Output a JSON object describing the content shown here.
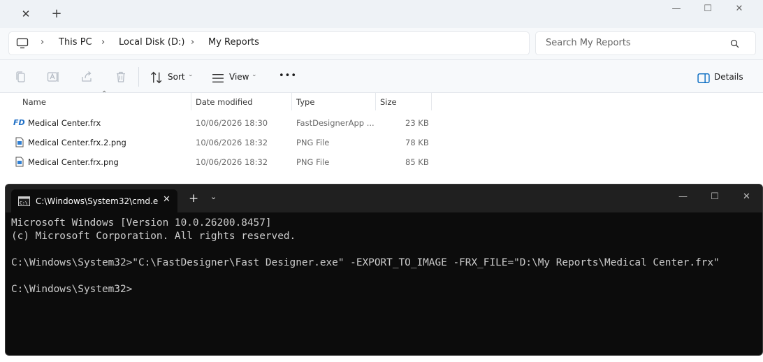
{
  "explorer": {
    "tab": {
      "close_glyph": "✕",
      "new_glyph": "+"
    },
    "window": {
      "minimize_glyph": "—",
      "maximize_glyph": "☐",
      "close_glyph": "✕"
    },
    "breadcrumb": [
      "This PC",
      "Local Disk (D:)",
      "My Reports"
    ],
    "breadcrumb_separator": "›",
    "search_placeholder": "Search My Reports",
    "toolbar": {
      "icons": [
        "copy-icon",
        "rename-icon",
        "share-icon",
        "delete-icon"
      ],
      "sort_label": "Sort",
      "view_label": "View",
      "more_label": "•••",
      "details_label": "Details"
    },
    "columns": [
      "Name",
      "Date modified",
      "Type",
      "Size"
    ],
    "files": [
      {
        "icon": "fd-app-icon",
        "icon_text": "FD",
        "name": "Medical Center.frx",
        "date": "10/06/2026 18:30",
        "type": "FastDesignerApp ...",
        "size": "23 KB"
      },
      {
        "icon": "png-file-icon",
        "name": "Medical Center.frx.2.png",
        "date": "10/06/2026 18:32",
        "type": "PNG File",
        "size": "78 KB"
      },
      {
        "icon": "png-file-icon",
        "name": "Medical Center.frx.png",
        "date": "10/06/2026 18:32",
        "type": "PNG File",
        "size": "85 KB"
      }
    ]
  },
  "terminal": {
    "tab_title": "C:\\Windows\\System32\\cmd.e",
    "tab_close_glyph": "✕",
    "new_tab_glyph": "+",
    "dropdown_glyph": "⌄",
    "window": {
      "minimize_glyph": "—",
      "maximize_glyph": "☐",
      "close_glyph": "✕"
    },
    "lines": [
      "Microsoft Windows [Version 10.0.26200.8457]",
      "(c) Microsoft Corporation. All rights reserved.",
      "",
      "C:\\Windows\\System32>\"C:\\FastDesigner\\Fast Designer.exe\" -EXPORT_TO_IMAGE -FRX_FILE=\"D:\\My Reports\\Medical Center.frx\"",
      "",
      "C:\\Windows\\System32>"
    ]
  },
  "colors": {
    "accent": "#0067c0",
    "terminal_bg": "#0c0c0c",
    "terminal_fg": "#cccccc"
  }
}
